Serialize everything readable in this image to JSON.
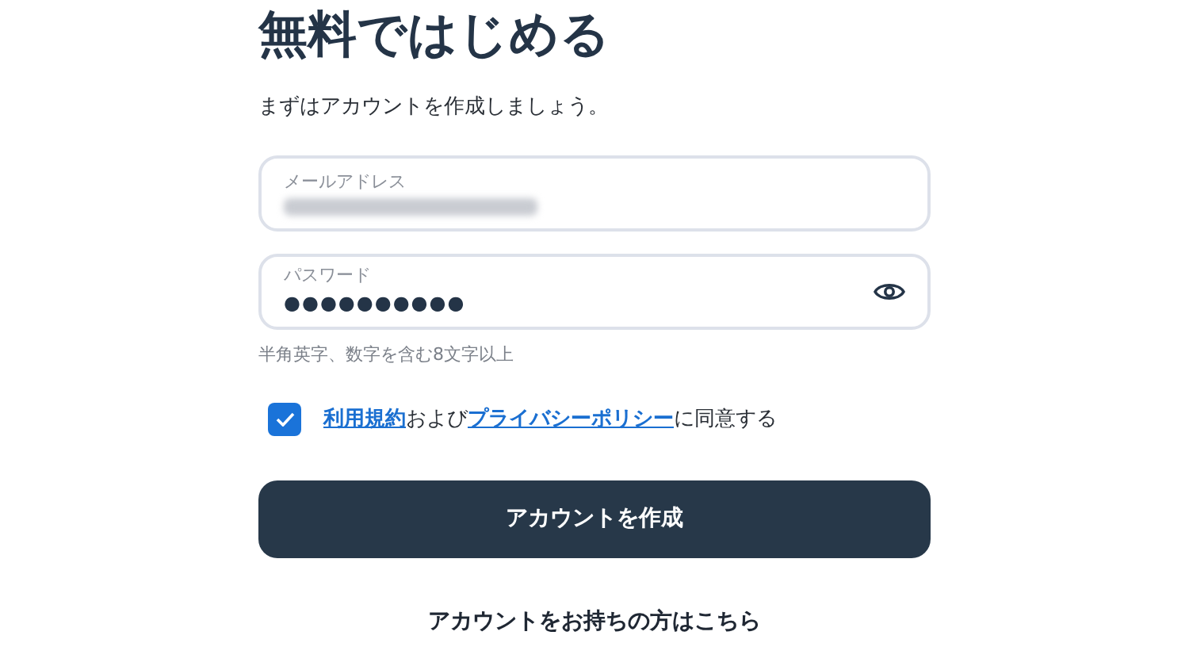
{
  "title": "無料ではじめる",
  "subtitle": "まずはアカウントを作成しましょう。",
  "email_field": {
    "label": "メールアドレス",
    "value_blurred": true
  },
  "password_field": {
    "label": "パスワード",
    "value": "●●●●●●●●●●",
    "show_password_icon": true
  },
  "password_hint": "半角英字、数字を含む8文字以上",
  "agreement": {
    "checked": true,
    "parts": [
      {
        "kind": "link",
        "text": "利用規約"
      },
      {
        "kind": "text",
        "text": "および"
      },
      {
        "kind": "link",
        "text": "プライバシーポリシー"
      },
      {
        "kind": "text",
        "text": "に同意する"
      }
    ]
  },
  "submit_button": "アカウントを作成",
  "login_link": "アカウントをお持ちの方はこちら"
}
